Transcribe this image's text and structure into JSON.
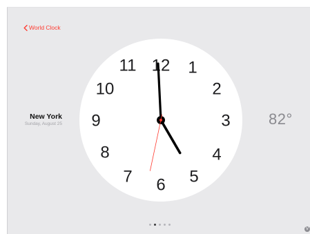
{
  "nav": {
    "back_label": "World Clock"
  },
  "city": {
    "name": "New York",
    "date": "Sunday, August 25"
  },
  "clock": {
    "numerals": [
      "12",
      "1",
      "2",
      "3",
      "4",
      "5",
      "6",
      "7",
      "8",
      "9",
      "10",
      "11"
    ],
    "time": {
      "hour": 4,
      "minute": 59,
      "second": 32
    }
  },
  "weather": {
    "temperature": "82°"
  },
  "pager": {
    "page_count": 5,
    "current_page": 2
  },
  "corner": {
    "label": "V"
  },
  "colors": {
    "accent": "#ff3b30",
    "background": "#e9e9eb",
    "face": "#ffffff",
    "hands": "#000000",
    "second_hand": "#ff3b30"
  }
}
